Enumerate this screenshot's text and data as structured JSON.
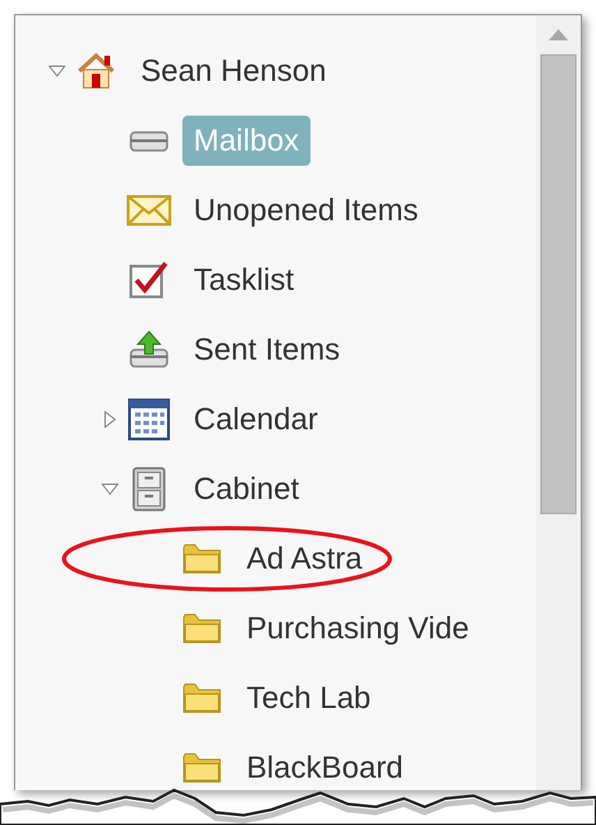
{
  "tree": [
    {
      "label": "Sean Henson",
      "kind": "home",
      "expanded": true,
      "selected": false,
      "children": [
        {
          "label": "Mailbox",
          "kind": "inbox",
          "selected": true
        },
        {
          "label": "Unopened Items",
          "kind": "envelope",
          "selected": false
        },
        {
          "label": "Tasklist",
          "kind": "tasks",
          "selected": false
        },
        {
          "label": "Sent Items",
          "kind": "outbox",
          "selected": false
        },
        {
          "label": "Calendar",
          "kind": "calendar",
          "expanded": false,
          "selected": false
        },
        {
          "label": "Cabinet",
          "kind": "cabinet",
          "expanded": true,
          "selected": false,
          "children": [
            {
              "label": "Ad Astra",
              "kind": "folder",
              "selected": false,
              "circled": true
            },
            {
              "label": "Purchasing Vide",
              "kind": "folder",
              "selected": false
            },
            {
              "label": "Tech Lab",
              "kind": "folder",
              "selected": false
            },
            {
              "label": "BlackBoard",
              "kind": "folder",
              "selected": false
            }
          ]
        }
      ]
    }
  ]
}
